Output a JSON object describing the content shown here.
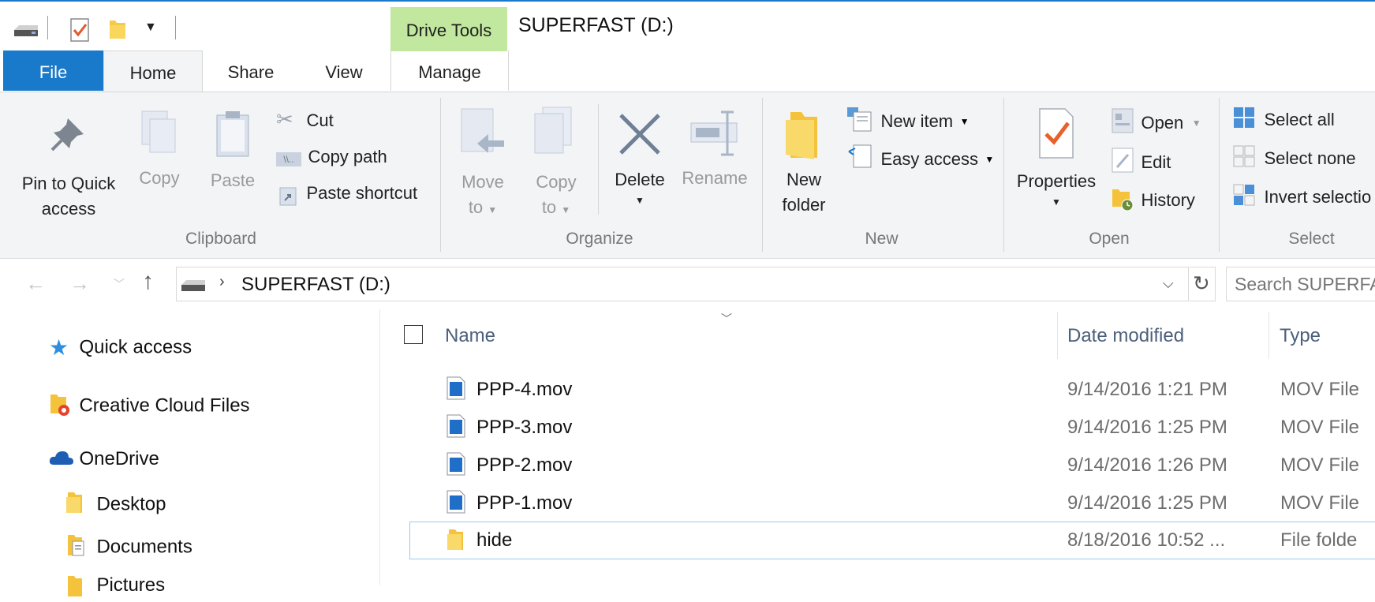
{
  "window": {
    "title": "SUPERFAST (D:)"
  },
  "tabs": {
    "drive_tools": "Drive Tools",
    "file": "File",
    "home": "Home",
    "share": "Share",
    "view": "View",
    "manage": "Manage"
  },
  "ribbon": {
    "clipboard": {
      "group_label": "Clipboard",
      "pin_line1": "Pin to Quick",
      "pin_line2": "access",
      "copy": "Copy",
      "paste": "Paste",
      "cut": "Cut",
      "copy_path": "Copy path",
      "paste_shortcut": "Paste shortcut"
    },
    "organize": {
      "group_label": "Organize",
      "move_line1": "Move",
      "move_line2": "to",
      "copy_line1": "Copy",
      "copy_line2": "to",
      "delete": "Delete",
      "rename": "Rename"
    },
    "new": {
      "group_label": "New",
      "new_folder_line1": "New",
      "new_folder_line2": "folder",
      "new_item": "New item",
      "easy_access": "Easy access"
    },
    "open": {
      "group_label": "Open",
      "properties": "Properties",
      "open": "Open",
      "edit": "Edit",
      "history": "History"
    },
    "select": {
      "group_label": "Select",
      "select_all": "Select all",
      "select_none": "Select none",
      "invert_selection": "Invert selectio"
    }
  },
  "address": {
    "path": "SUPERFAST (D:)",
    "search_placeholder": "Search SUPERFA"
  },
  "nav": {
    "quick_access": "Quick access",
    "creative_cloud": "Creative Cloud Files",
    "onedrive": "OneDrive",
    "desktop": "Desktop",
    "documents": "Documents",
    "pictures": "Pictures"
  },
  "columns": {
    "name": "Name",
    "date_modified": "Date modified",
    "type": "Type"
  },
  "files": [
    {
      "name": "PPP-4.mov",
      "date": "9/14/2016 1:21 PM",
      "type": "MOV File",
      "icon": "video-file-icon"
    },
    {
      "name": "PPP-3.mov",
      "date": "9/14/2016 1:25 PM",
      "type": "MOV File",
      "icon": "video-file-icon"
    },
    {
      "name": "PPP-2.mov",
      "date": "9/14/2016 1:26 PM",
      "type": "MOV File",
      "icon": "video-file-icon"
    },
    {
      "name": "PPP-1.mov",
      "date": "9/14/2016 1:25 PM",
      "type": "MOV File",
      "icon": "video-file-icon"
    },
    {
      "name": "hide",
      "date": "8/18/2016 10:52 ...",
      "type": "File folde",
      "icon": "folder-icon"
    }
  ],
  "colors": {
    "accent": "#1979ca",
    "drive_tools": "#c2e8a0",
    "ribbon_bg": "#f3f4f5",
    "selection_border": "#99c9ef"
  }
}
